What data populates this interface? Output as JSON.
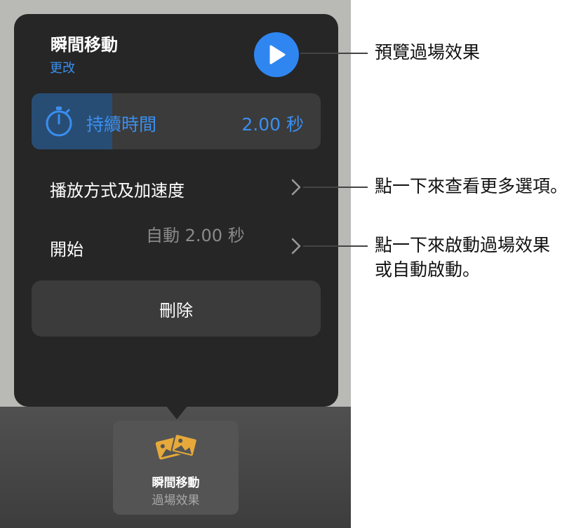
{
  "popover": {
    "title": "瞬間移動",
    "change_link": "更改",
    "duration": {
      "label": "持續時間",
      "value": "2.00 秒",
      "fill_fraction": 0.28
    },
    "playback_label": "播放方式及加速度",
    "start": {
      "label": "開始",
      "value": "自動  2.00 秒"
    },
    "delete_label": "刪除"
  },
  "bottom_card": {
    "title": "瞬間移動",
    "subtitle": "過場效果"
  },
  "callouts": {
    "preview": "預覽過場效果",
    "more_options": "點一下來查看更多選項。",
    "start_line1": "點一下來啟動過場效果",
    "start_line2": "或自動啟動。"
  },
  "colors": {
    "accent": "#2f86f0",
    "popover_bg": "#262626",
    "row_bg": "#3b3b3b",
    "card_icon": "#e6a93a"
  },
  "icons": {
    "play": "play-icon",
    "timer": "stopwatch-icon",
    "chevron": "chevron-right-icon",
    "transition": "transition-photos-icon"
  }
}
